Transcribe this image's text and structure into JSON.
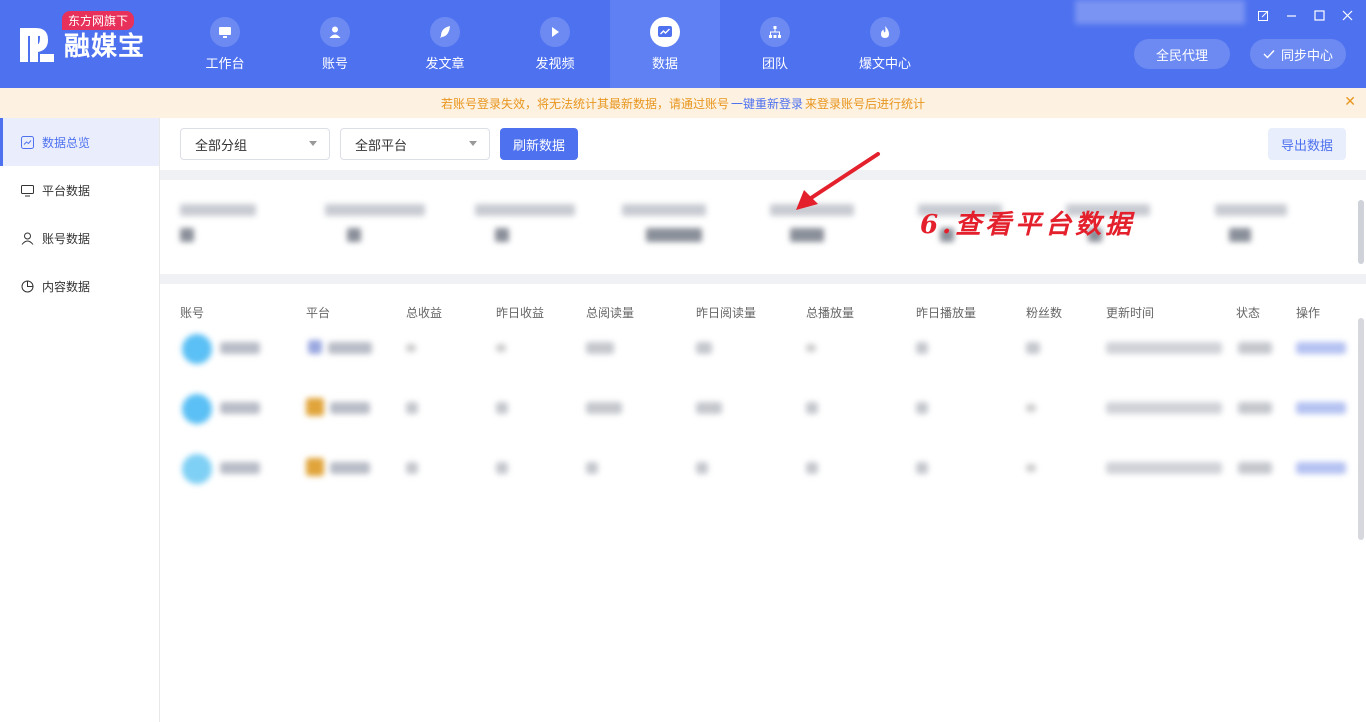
{
  "app": {
    "name": "融媒宝",
    "badge": "东方网旗下"
  },
  "nav": [
    {
      "label": "工作台",
      "icon": "monitor-icon",
      "active": false
    },
    {
      "label": "账号",
      "icon": "user-icon",
      "active": false
    },
    {
      "label": "发文章",
      "icon": "feather-icon",
      "active": false
    },
    {
      "label": "发视频",
      "icon": "play-icon",
      "active": false
    },
    {
      "label": "数据",
      "icon": "chart-icon",
      "active": true
    },
    {
      "label": "团队",
      "icon": "org-icon",
      "active": false
    },
    {
      "label": "爆文中心",
      "icon": "flame-icon",
      "active": false
    }
  ],
  "header_buttons": {
    "agent": "全民代理",
    "sync": "同步中心"
  },
  "notice": {
    "prefix": "若账号登录失效，将无法统计其最新数据，请通过账号",
    "link": "一键重新登录",
    "suffix": "来登录账号后进行统计"
  },
  "sidebar": [
    {
      "label": "数据总览",
      "icon": "trend-chart-icon",
      "active": true
    },
    {
      "label": "平台数据",
      "icon": "monitor-icon",
      "active": false
    },
    {
      "label": "账号数据",
      "icon": "user-icon",
      "active": false
    },
    {
      "label": "内容数据",
      "icon": "pie-icon",
      "active": false
    }
  ],
  "toolbar": {
    "group_select": "全部分组",
    "platform_select": "全部平台",
    "refresh": "刷新数据",
    "export": "导出数据"
  },
  "annotation": "6.查看平台数据",
  "table": {
    "headers": [
      "账号",
      "平台",
      "总收益",
      "昨日收益",
      "总阅读量",
      "昨日阅读量",
      "总播放量",
      "昨日播放量",
      "粉丝数",
      "更新时间",
      "状态",
      "操作"
    ]
  },
  "colors": {
    "brand": "#4e71ef",
    "notice_text": "#e8961d",
    "annotation": "#e3202c"
  }
}
